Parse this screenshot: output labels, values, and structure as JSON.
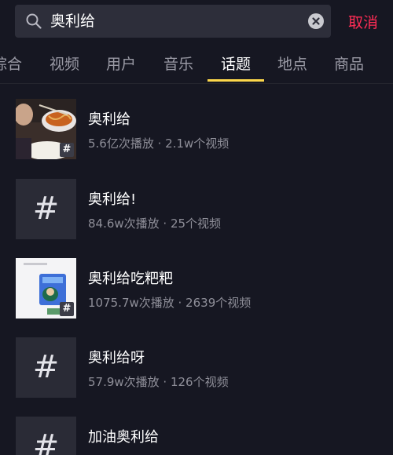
{
  "search": {
    "query": "奥利给"
  },
  "cancel_label": "取消",
  "tabs": [
    {
      "label": "综合"
    },
    {
      "label": "视频"
    },
    {
      "label": "用户"
    },
    {
      "label": "音乐"
    },
    {
      "label": "话题"
    },
    {
      "label": "地点"
    },
    {
      "label": "商品"
    }
  ],
  "active_tab": "话题",
  "results": [
    {
      "title": "奥利给",
      "meta": "5.6亿次播放 · 2.1w个视频",
      "thumbnail": "noodles-photo"
    },
    {
      "title": "奥利给!",
      "meta": "84.6w次播放 · 25个视频",
      "thumbnail": "hashtag-placeholder"
    },
    {
      "title": "奥利给吃粑粑",
      "meta": "1075.7w次播放 · 2639个视频",
      "thumbnail": "app-screenshot"
    },
    {
      "title": "奥利给呀",
      "meta": "57.9w次播放 · 126个视频",
      "thumbnail": "hashtag-placeholder"
    },
    {
      "title": "加油奥利给",
      "meta": "",
      "thumbnail": "hashtag-placeholder"
    }
  ],
  "colors": {
    "background": "#161722",
    "accent_underline": "#fcd74b",
    "cancel": "#fe2c55"
  }
}
